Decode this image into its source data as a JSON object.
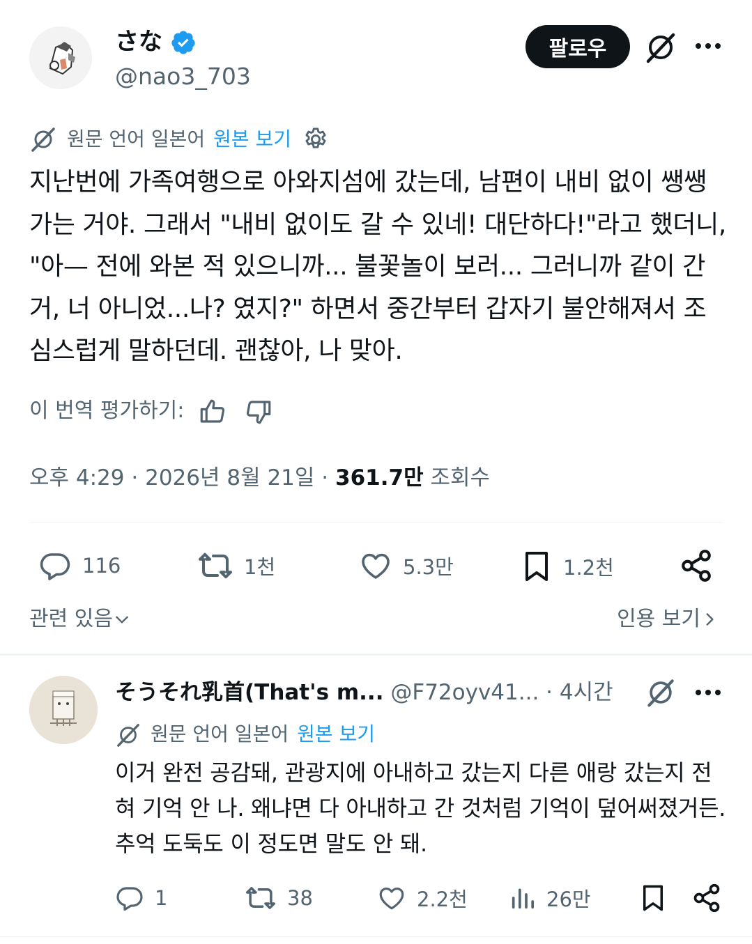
{
  "post": {
    "author_name": "さな",
    "author_handle": "@nao3_703",
    "follow_label": "팔로우",
    "translation": {
      "prefix": "원문 언어 일본어",
      "view_original": "원본 보기"
    },
    "body": "지난번에 가족여행으로 아와지섬에 갔는데, 남편이 내비 없이 쌩쌩 가는 거야. 그래서 \"내비 없이도 갈 수 있네! 대단하다!\"라고 했더니, \"아— 전에 와본 적 있으니까... 불꽃놀이 보러... 그러니까 같이 간 거, 너 아니었...나? 였지?\" 하면서 중간부터 갑자기 불안해져서 조심스럽게 말하던데. 괜찮아, 나 맞아.",
    "rate_label": "이 번역 평가하기:",
    "time": "오후 4:29",
    "date": "2026년 8월 21일",
    "views_count": "361.7만",
    "views_label": "조회수",
    "actions": {
      "replies": "116",
      "reposts": "1천",
      "likes": "5.3만",
      "bookmarks": "1.2천"
    },
    "related_label": "관련 있음",
    "quotes_label": "인용 보기"
  },
  "reply": {
    "author_name": "そうそれ乳首(That's m...",
    "author_handle": "@F72oyv41...",
    "time": "· 4시간",
    "translation": {
      "prefix": "원문 언어 일본어",
      "view_original": "원본 보기"
    },
    "body": "이거 완전 공감돼, 관광지에 아내하고 갔는지 다른 애랑 갔는지 전혀 기억 안 나. 왜냐면 다 아내하고 간 것처럼 기억이 덮어써졌거든. 추억 도둑도 이 정도면 말도 안 돼.",
    "actions": {
      "replies": "1",
      "reposts": "38",
      "likes": "2.2천",
      "views": "26만"
    }
  },
  "colors": {
    "text": "#0f1419",
    "secondary": "#536471",
    "accent": "#1d9bf0",
    "button_bg": "#0f1419"
  },
  "icons": [
    "verified-badge-icon",
    "grok-icon",
    "more-icon",
    "translate-icon",
    "gear-icon",
    "thumbs-up-icon",
    "thumbs-down-icon",
    "reply-icon",
    "repost-icon",
    "like-icon",
    "bookmark-icon",
    "share-icon",
    "views-icon",
    "chevron-down-icon",
    "chevron-right-icon"
  ]
}
